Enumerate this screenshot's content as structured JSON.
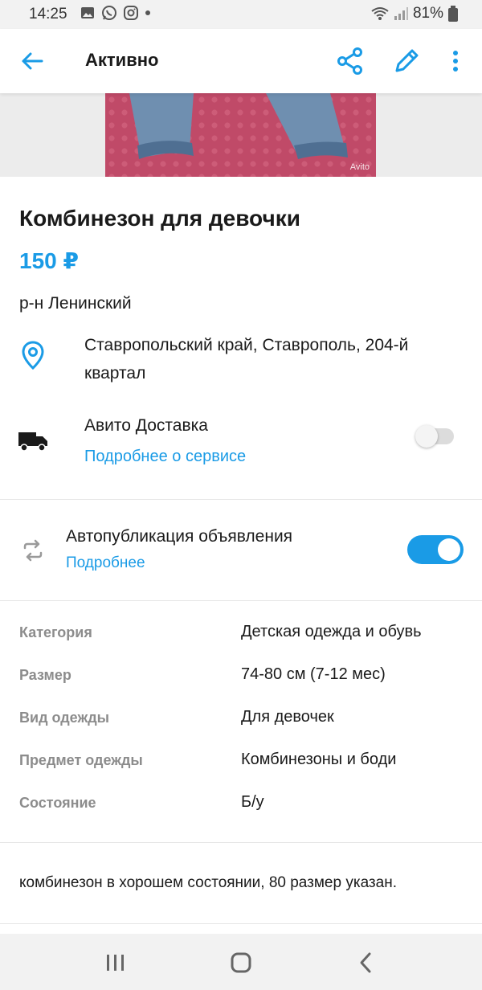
{
  "status_bar": {
    "time": "14:25",
    "battery": "81%"
  },
  "app_bar": {
    "title": "Активно"
  },
  "photo": {
    "watermark": "Avito"
  },
  "ad": {
    "title": "Комбинезон для девочки",
    "price": "150 ₽",
    "district": "р-н Ленинский",
    "address": "Ставропольский край, Ставрополь, 204-й квартал"
  },
  "delivery": {
    "title": "Авито Доставка",
    "link": "Подробнее о сервисе",
    "enabled": false
  },
  "autopublish": {
    "title": "Автопубликация объявления",
    "link": "Подробнее",
    "enabled": true
  },
  "params": [
    {
      "label": "Категория",
      "value": "Детская одежда и обувь"
    },
    {
      "label": "Размер",
      "value": "74-80 см (7-12 мес)"
    },
    {
      "label": "Вид одежды",
      "value": "Для девочек"
    },
    {
      "label": "Предмет одежды",
      "value": "Комбинезоны и боди"
    },
    {
      "label": "Состояние",
      "value": "Б/у"
    }
  ],
  "description": "комбинезон в хорошем состоянии,  80 размер указан.",
  "colors": {
    "accent": "#1a9be6",
    "toggle_off": "#dcdcdc"
  }
}
